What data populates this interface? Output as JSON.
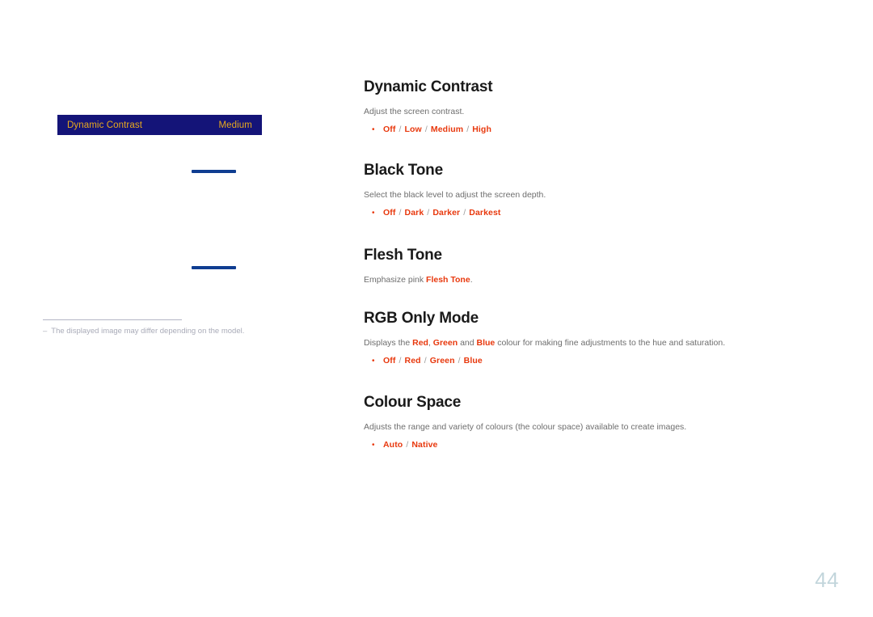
{
  "page": {
    "number": "44",
    "accent_color": "#e8380d",
    "heading_color": "#1a1a1a",
    "body_color": "#6e6e6e",
    "osd_bar_color": "#141478",
    "osd_text_color": "#e8a91d",
    "blue_bar_color": "#0f3d91",
    "page_number_color": "#c3d6dc"
  },
  "illustration": {
    "osd_menu": {
      "label": "Dynamic Contrast",
      "value": "Medium"
    },
    "footnote": {
      "dash": "‒",
      "text": "The displayed image may differ depending on the model."
    }
  },
  "sections": [
    {
      "id": "dynamic-contrast",
      "heading": "Dynamic Contrast",
      "description_parts": [
        {
          "text": "Adjust the screen contrast.",
          "highlight": false
        }
      ],
      "bullet": "•",
      "options": [
        "Off",
        "Low",
        "Medium",
        "High"
      ],
      "separator": "/"
    },
    {
      "id": "black-tone",
      "heading": "Black Tone",
      "description_parts": [
        {
          "text": "Select the black level to adjust the screen depth.",
          "highlight": false
        }
      ],
      "bullet": "•",
      "options": [
        "Off",
        "Dark",
        "Darker",
        "Darkest"
      ],
      "separator": "/"
    },
    {
      "id": "flesh-tone",
      "heading": "Flesh Tone",
      "description_parts": [
        {
          "text": "Emphasize pink ",
          "highlight": false
        },
        {
          "text": "Flesh Tone",
          "highlight": true
        },
        {
          "text": ".",
          "highlight": false
        }
      ],
      "bullet": null,
      "options": [],
      "separator": "/"
    },
    {
      "id": "rgb-only-mode",
      "heading": "RGB Only Mode",
      "description_parts": [
        {
          "text": "Displays the ",
          "highlight": false
        },
        {
          "text": "Red",
          "highlight": true
        },
        {
          "text": ", ",
          "highlight": false
        },
        {
          "text": "Green",
          "highlight": true
        },
        {
          "text": " and ",
          "highlight": false
        },
        {
          "text": "Blue",
          "highlight": true
        },
        {
          "text": " colour for making fine adjustments to the hue and saturation.",
          "highlight": false
        }
      ],
      "bullet": "•",
      "options": [
        "Off",
        "Red",
        "Green",
        "Blue"
      ],
      "separator": "/"
    },
    {
      "id": "colour-space",
      "heading": "Colour Space",
      "description_parts": [
        {
          "text": "Adjusts the range and variety of colours (the colour space) available to create images.",
          "highlight": false
        }
      ],
      "bullet": "•",
      "options": [
        "Auto",
        "Native"
      ],
      "separator": "/"
    }
  ]
}
